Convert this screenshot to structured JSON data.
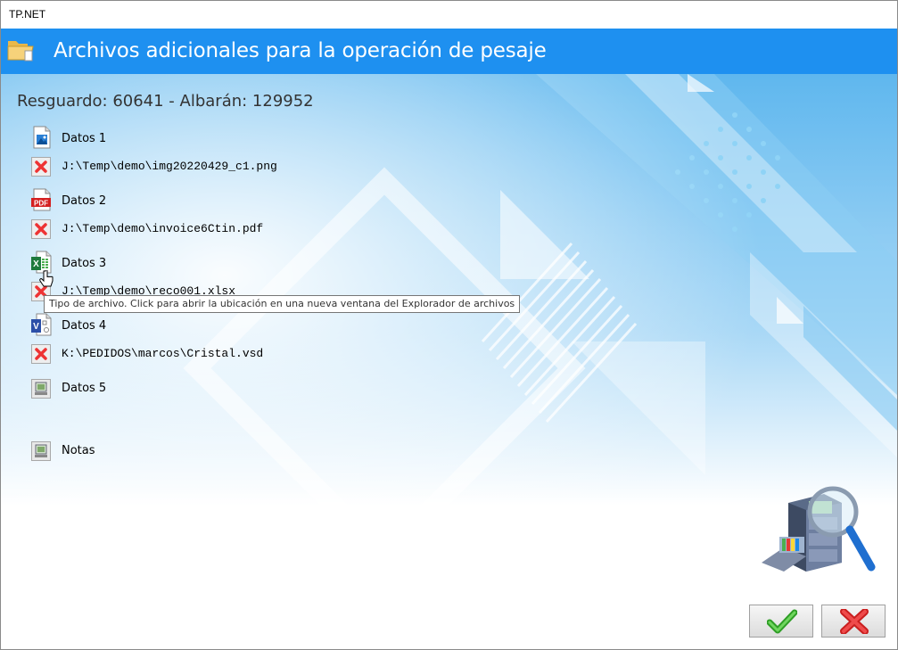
{
  "window": {
    "title": "TP.NET"
  },
  "header": {
    "title": "Archivos adicionales para la operación de pesaje"
  },
  "subtitle": "Resguardo: 60641 - Albarán: 129952",
  "items": [
    {
      "label": "Datos 1",
      "icon": "image-file-icon",
      "path": "J:\\Temp\\demo\\img20220429_c1.png"
    },
    {
      "label": "Datos 2",
      "icon": "pdf-file-icon",
      "path": "J:\\Temp\\demo\\invoice6Ctin.pdf"
    },
    {
      "label": "Datos 3",
      "icon": "excel-file-icon",
      "path": "J:\\Temp\\demo\\reco001.xlsx"
    },
    {
      "label": "Datos 4",
      "icon": "visio-file-icon",
      "path": "K:\\PEDIDOS\\marcos\\Cristal.vsd"
    },
    {
      "label": "Datos 5",
      "icon": "attach-file-icon"
    }
  ],
  "notes": {
    "label": "Notas",
    "icon": "attach-file-icon"
  },
  "tooltip": "Tipo de archivo. Click para abrir la ubicación en una nueva ventana del Explorador de archivos",
  "buttons": {
    "ok_icon": "checkmark-icon",
    "cancel_icon": "red-x-icon"
  },
  "colors": {
    "header": "#1e90f0",
    "ok": "#3db832",
    "cancel": "#e12b2b"
  }
}
